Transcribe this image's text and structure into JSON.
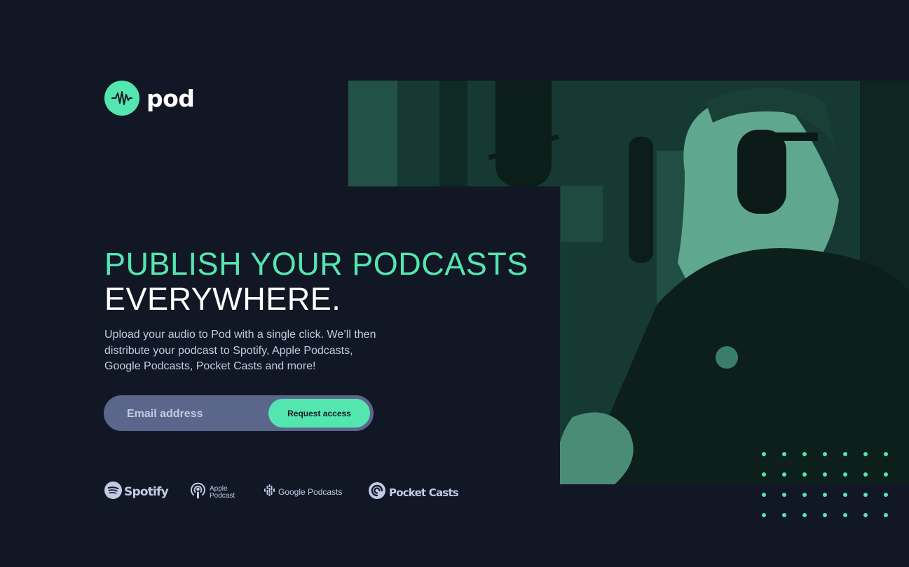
{
  "brand": {
    "name": "pod",
    "logo_icon": "waveform-icon"
  },
  "hero": {
    "headline_accent": "PUBLISH YOUR PODCASTS",
    "headline_main": "EVERYWHERE.",
    "description": "Upload your audio to Pod with a single click. We’ll then distribute your podcast to Spotify, Apple Podcasts, Google Podcasts, Pocket Casts and more!"
  },
  "signup": {
    "email_placeholder": "Email address",
    "email_value": "",
    "button_label": "Request access"
  },
  "platforms": [
    {
      "name": "Spotify",
      "icon": "spotify-icon"
    },
    {
      "name": "Apple Podcast",
      "icon": "apple-podcast-icon"
    },
    {
      "name": "Google Podcasts",
      "icon": "google-podcasts-icon"
    },
    {
      "name": "Pocket Casts",
      "icon": "pocket-casts-icon"
    }
  ],
  "colors": {
    "background": "#121725",
    "accent": "#54e6af",
    "text_muted": "#c2cbe5",
    "input_background": "#5a668a",
    "white": "#ffffff"
  }
}
